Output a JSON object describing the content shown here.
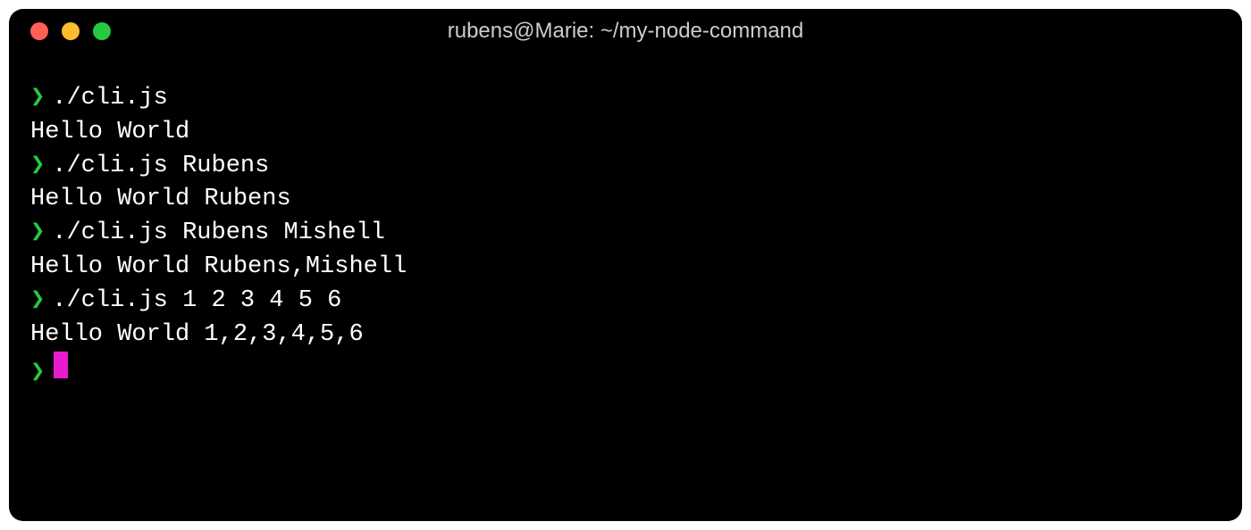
{
  "window": {
    "title": "rubens@Marie: ~/my-node-command"
  },
  "terminal": {
    "prompt_symbol": "❯",
    "lines": [
      {
        "type": "command",
        "text": "./cli.js"
      },
      {
        "type": "output",
        "text": "Hello World"
      },
      {
        "type": "command",
        "text": "./cli.js Rubens"
      },
      {
        "type": "output",
        "text": "Hello World Rubens"
      },
      {
        "type": "command",
        "text": "./cli.js Rubens Mishell"
      },
      {
        "type": "output",
        "text": "Hello World Rubens,Mishell"
      },
      {
        "type": "command",
        "text": "./cli.js 1 2 3 4 5 6"
      },
      {
        "type": "output",
        "text": "Hello World 1,2,3,4,5,6"
      },
      {
        "type": "prompt",
        "text": ""
      }
    ]
  },
  "colors": {
    "close": "#ff5f57",
    "minimize": "#ffbd2e",
    "maximize": "#28c940",
    "prompt": "#28c940",
    "cursor": "#e91bcc",
    "text": "#ffffff",
    "background": "#000000"
  }
}
